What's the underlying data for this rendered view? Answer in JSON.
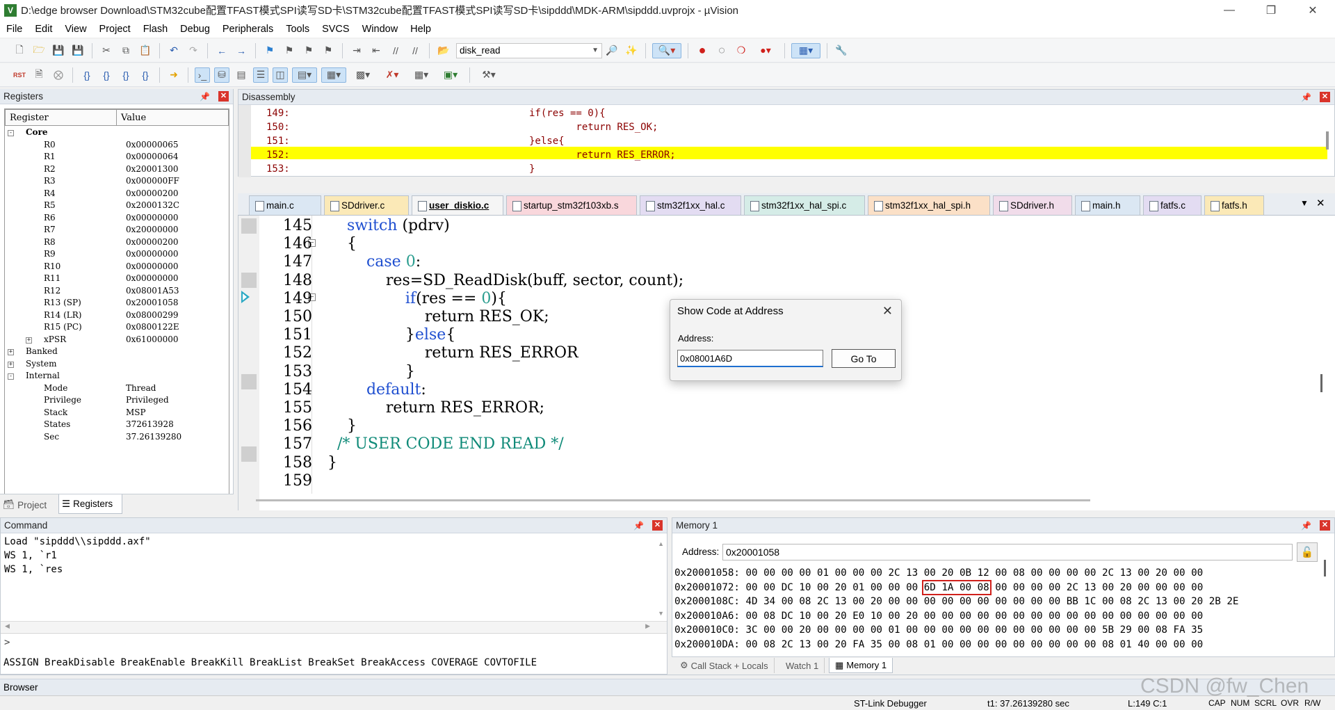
{
  "window": {
    "title": "D:\\edge browser Download\\STM32cube配置TFAST模式SPI读写SD卡\\STM32cube配置TFAST模式SPI读写SD卡\\sipddd\\MDK-ARM\\sipddd.uvprojx - µVision",
    "app_icon": "V"
  },
  "menu": [
    "File",
    "Edit",
    "View",
    "Project",
    "Flash",
    "Debug",
    "Peripherals",
    "Tools",
    "SVCS",
    "Window",
    "Help"
  ],
  "toolbar": {
    "function_combo": "disk_read"
  },
  "registers": {
    "title": "Registers",
    "col_register": "Register",
    "col_value": "Value",
    "core_label": "Core",
    "core": [
      {
        "name": "R0",
        "value": "0x00000065"
      },
      {
        "name": "R1",
        "value": "0x00000064"
      },
      {
        "name": "R2",
        "value": "0x20001300"
      },
      {
        "name": "R3",
        "value": "0x000000FF"
      },
      {
        "name": "R4",
        "value": "0x00000200"
      },
      {
        "name": "R5",
        "value": "0x2000132C"
      },
      {
        "name": "R6",
        "value": "0x00000000"
      },
      {
        "name": "R7",
        "value": "0x20000000"
      },
      {
        "name": "R8",
        "value": "0x00000200"
      },
      {
        "name": "R9",
        "value": "0x00000000"
      },
      {
        "name": "R10",
        "value": "0x00000000"
      },
      {
        "name": "R11",
        "value": "0x00000000"
      },
      {
        "name": "R12",
        "value": "0x08001A53"
      },
      {
        "name": "R13 (SP)",
        "value": "0x20001058"
      },
      {
        "name": "R14 (LR)",
        "value": "0x08000299"
      },
      {
        "name": "R15 (PC)",
        "value": "0x0800122E"
      },
      {
        "name": "xPSR",
        "value": "0x61000000"
      }
    ],
    "groups": [
      "Banked",
      "System",
      "Internal"
    ],
    "internal": [
      {
        "name": "Mode",
        "value": "Thread"
      },
      {
        "name": "Privilege",
        "value": "Privileged"
      },
      {
        "name": "Stack",
        "value": "MSP"
      },
      {
        "name": "States",
        "value": "372613928"
      },
      {
        "name": "Sec",
        "value": "37.26139280"
      }
    ],
    "tabs": [
      "Project",
      "Registers"
    ]
  },
  "disassembly": {
    "title": "Disassembly",
    "lines": [
      {
        "num": "149:",
        "code": "if(res == 0){"
      },
      {
        "num": "150:",
        "code": "        return RES_OK;"
      },
      {
        "num": "151:",
        "code": "}else{"
      },
      {
        "num": "152:",
        "code": "        return RES_ERROR;"
      },
      {
        "num": "153:",
        "code": "}"
      }
    ]
  },
  "editor": {
    "tabs": [
      {
        "label": "main.c",
        "color": "#dbe7f3"
      },
      {
        "label": "SDdriver.c",
        "color": "#fbe9b7"
      },
      {
        "label": "user_diskio.c",
        "color": "#f5f5f5"
      },
      {
        "label": "startup_stm32f103xb.s",
        "color": "#f9d7dc"
      },
      {
        "label": "stm32f1xx_hal.c",
        "color": "#e3dcf2"
      },
      {
        "label": "stm32f1xx_hal_spi.c",
        "color": "#d5ece7"
      },
      {
        "label": "stm32f1xx_hal_spi.h",
        "color": "#fbe0c7"
      },
      {
        "label": "SDdriver.h",
        "color": "#f1dcea"
      },
      {
        "label": "main.h",
        "color": "#dbe7f3"
      },
      {
        "label": "fatfs.c",
        "color": "#e3dcf2"
      },
      {
        "label": "fatfs.h",
        "color": "#fbe9b7"
      }
    ],
    "lines": [
      {
        "num": "145",
        "text": "    switch (pdrv)"
      },
      {
        "num": "146",
        "text": "    {"
      },
      {
        "num": "147",
        "text": "        case 0:"
      },
      {
        "num": "148",
        "text": "            res=SD_ReadDisk(buff, sector, count);"
      },
      {
        "num": "149",
        "text": "                if(res == 0){"
      },
      {
        "num": "150",
        "text": "                    return RES_OK;"
      },
      {
        "num": "151",
        "text": "                }else{"
      },
      {
        "num": "152",
        "text": "                    return RES_ERROR"
      },
      {
        "num": "153",
        "text": "                }"
      },
      {
        "num": "154",
        "text": "        default:"
      },
      {
        "num": "155",
        "text": "            return RES_ERROR;"
      },
      {
        "num": "156",
        "text": "    }"
      },
      {
        "num": "157",
        "text": "  /* USER CODE END READ */"
      },
      {
        "num": "158",
        "text": "}"
      },
      {
        "num": "159",
        "text": ""
      }
    ]
  },
  "dialog": {
    "title": "Show Code at Address",
    "address_label": "Address:",
    "address_value": "0x08001A6D",
    "go_button": "Go To"
  },
  "command": {
    "title": "Command",
    "lines": [
      "Load \"sipddd\\\\sipddd.axf\"",
      "WS 1, `r1",
      "WS 1, `res"
    ],
    "prompt": ">",
    "hints": "ASSIGN BreakDisable BreakEnable BreakKill BreakList BreakSet BreakAccess COVERAGE COVTOFILE"
  },
  "memory": {
    "title": "Memory 1",
    "address_label": "Address:",
    "address_value": "0x20001058",
    "rows": [
      {
        "addr": "0x20001058:",
        "pre": "00 00 00 00 01 00 00 00 2C 13 00 20 0B 12 00 08 00 00 00 00 2C 13 00 20 00 00",
        "hl": "",
        "post": ""
      },
      {
        "addr": "0x20001072:",
        "pre": "00 00 DC 10 00 20 01 00 00 00 ",
        "hl": "6D 1A 00 08",
        "post": " 00 00 00 00 2C 13 00 20 00 00 00 00"
      },
      {
        "addr": "0x2000108C:",
        "pre": "4D 34 00 08 2C 13 00 20 00 00 00 00 00 00 00 00 00 00 BB 1C 00 08 2C 13 00 20 2B 2E",
        "hl": "",
        "post": ""
      },
      {
        "addr": "0x200010A6:",
        "pre": "00 08 DC 10 00 20 E0 10 00 20 00 00 00 00 00 00 00 00 00 00 00 00 00 00 00 00",
        "hl": "",
        "post": ""
      },
      {
        "addr": "0x200010C0:",
        "pre": "3C 00 00 20 00 00 00 00 01 00 00 00 00 00 00 00 00 00 00 00 5B 29 00 08 FA 35",
        "hl": "",
        "post": ""
      },
      {
        "addr": "0x200010DA:",
        "pre": "00 08 2C 13 00 20 FA 35 00 08 01 00 00 00 00 00 00 00 00 00 08 01 40 00 00 00",
        "hl": "",
        "post": ""
      }
    ],
    "tabs": [
      "Call Stack + Locals",
      "Watch 1",
      "Memory 1"
    ]
  },
  "browser": {
    "title": "Browser"
  },
  "statusbar": {
    "debugger": "ST-Link Debugger",
    "time": "t1: 37.26139280 sec",
    "position": "L:149 C:1",
    "indicators": [
      "CAP",
      "NUM",
      "SCRL",
      "OVR",
      "R/W"
    ]
  },
  "watermark": "CSDN @fw_Chen"
}
